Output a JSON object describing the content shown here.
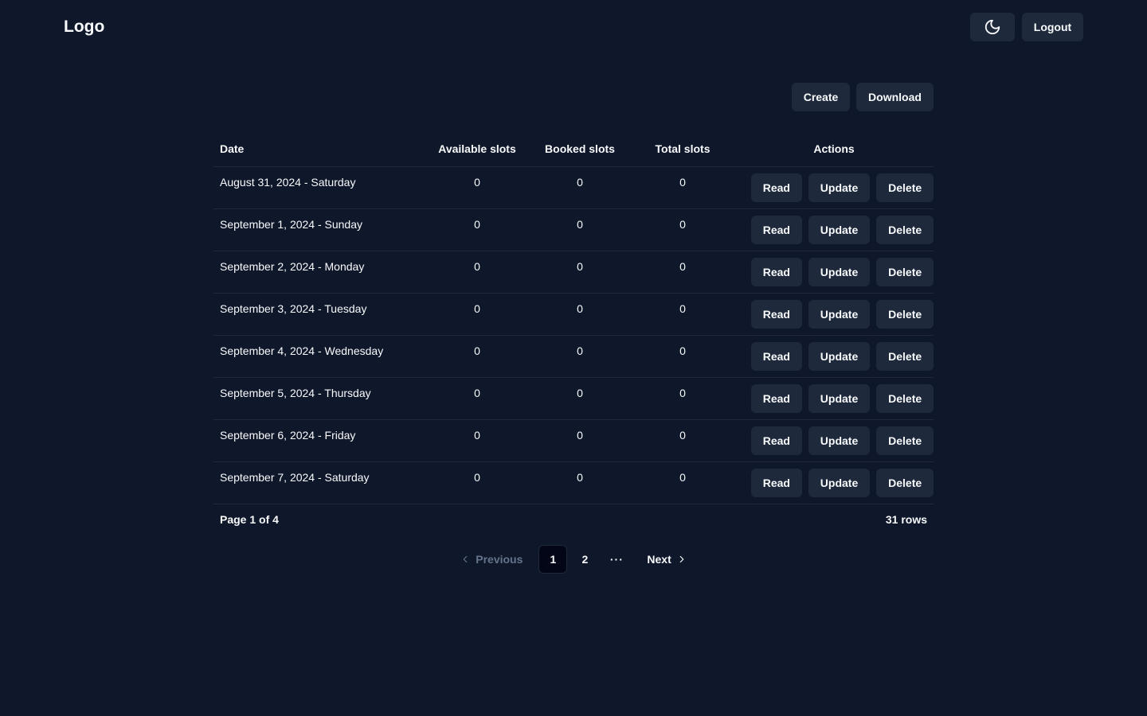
{
  "header": {
    "logo": "Logo",
    "logout_label": "Logout",
    "theme_icon": "moon-icon"
  },
  "toolbar": {
    "create_label": "Create",
    "download_label": "Download"
  },
  "table": {
    "columns": [
      "Date",
      "Available slots",
      "Booked slots",
      "Total slots",
      "Actions"
    ],
    "rows": [
      {
        "date": "August 31, 2024 - Saturday",
        "available": "0",
        "booked": "0",
        "total": "0"
      },
      {
        "date": "September 1, 2024 - Sunday",
        "available": "0",
        "booked": "0",
        "total": "0"
      },
      {
        "date": "September 2, 2024 - Monday",
        "available": "0",
        "booked": "0",
        "total": "0"
      },
      {
        "date": "September 3, 2024 - Tuesday",
        "available": "0",
        "booked": "0",
        "total": "0"
      },
      {
        "date": "September 4, 2024 - Wednesday",
        "available": "0",
        "booked": "0",
        "total": "0"
      },
      {
        "date": "September 5, 2024 - Thursday",
        "available": "0",
        "booked": "0",
        "total": "0"
      },
      {
        "date": "September 6, 2024 - Friday",
        "available": "0",
        "booked": "0",
        "total": "0"
      },
      {
        "date": "September 7, 2024 - Saturday",
        "available": "0",
        "booked": "0",
        "total": "0"
      }
    ],
    "row_actions": {
      "read": "Read",
      "update": "Update",
      "delete": "Delete"
    }
  },
  "footer": {
    "page_info": "Page 1 of 4",
    "row_count": "31 rows"
  },
  "pagination": {
    "previous_label": "Previous",
    "next_label": "Next",
    "pages": [
      "1",
      "2"
    ],
    "current_page": "1",
    "ellipsis": "···"
  },
  "colors": {
    "background": "#0f172a",
    "button": "#1e293b",
    "text": "#f8fafc",
    "muted": "#64748b"
  }
}
